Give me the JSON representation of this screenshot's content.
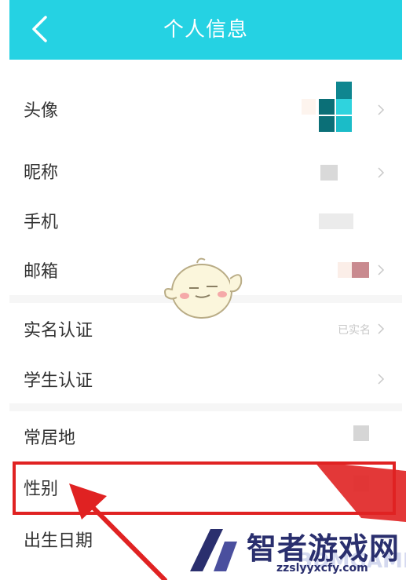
{
  "header": {
    "title": "个人信息",
    "back_icon": "chevron-left-icon",
    "bg_color": "#25d2e3"
  },
  "rows": [
    {
      "label": "头像"
    },
    {
      "label": "昵称"
    },
    {
      "label": "手机"
    },
    {
      "label": "邮箱"
    },
    {
      "label": "实名认证",
      "value": "已实名"
    },
    {
      "label": "学生认证"
    },
    {
      "label": "常居地"
    },
    {
      "label": "性别"
    },
    {
      "label": "出生日期"
    }
  ],
  "annotation": {
    "color": "#e02222"
  },
  "watermark": {
    "title": "智者游戏网",
    "site": "zzslyyxcfy.com",
    "alt": "3DMGAME"
  }
}
